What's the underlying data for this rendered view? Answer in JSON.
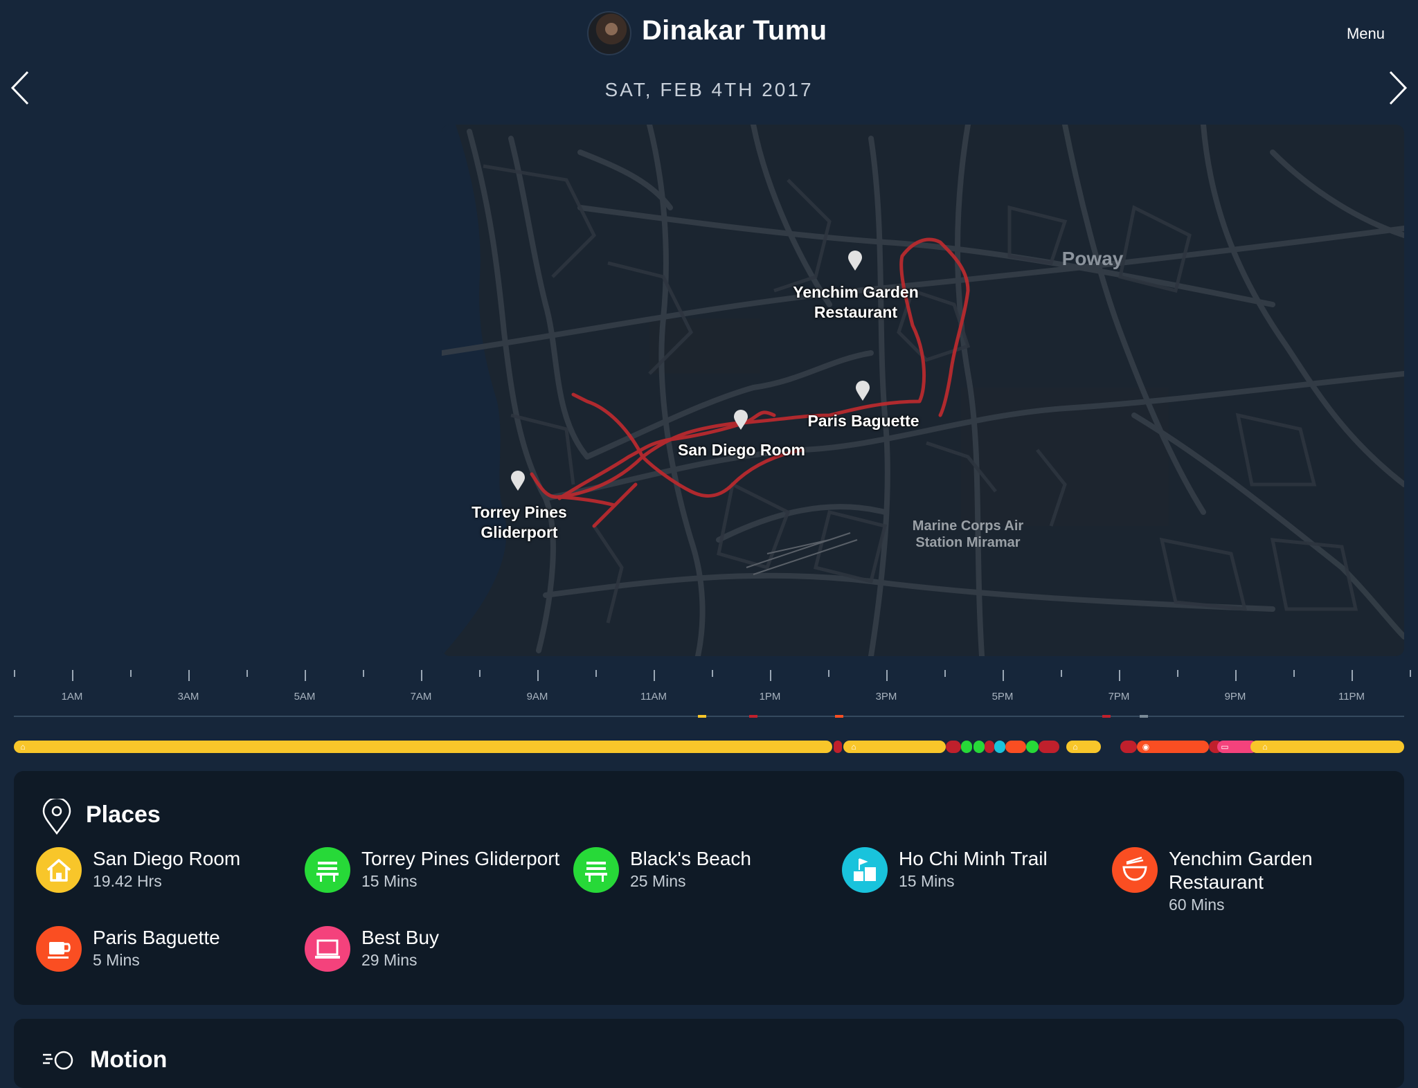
{
  "header": {
    "user_name": "Dinakar Tumu",
    "menu_label": "Menu",
    "date": "SAT, FEB 4TH 2017"
  },
  "map": {
    "places": [
      {
        "name": "Yenchim Garden\nRestaurant"
      },
      {
        "name": "Paris Baguette"
      },
      {
        "name": "San Diego Room"
      },
      {
        "name": "Torrey Pines\nGliderport"
      }
    ],
    "area_labels": [
      "Poway"
    ],
    "landmark_labels": [
      "Marine Corps Air\nStation Miramar"
    ],
    "route_color": "#b82a2e"
  },
  "timeline": {
    "hour_labels": [
      "1AM",
      "3AM",
      "5AM",
      "7AM",
      "9AM",
      "11AM",
      "1PM",
      "3PM",
      "5PM",
      "7PM",
      "9PM",
      "11PM"
    ],
    "colors": {
      "home": "#f8c62a",
      "transit": "#c0202c",
      "park": "#27d938",
      "trail": "#19c3dc",
      "restaurant": "#fa4e22",
      "cafe": "#fa4e22",
      "shop": "#f4427c"
    }
  },
  "places_card": {
    "title": "Places",
    "items": [
      {
        "name": "San Diego Room",
        "duration": "19.42 Hrs",
        "icon": "home-icon",
        "color": "#f8c62a"
      },
      {
        "name": "Torrey Pines Gliderport",
        "duration": "15 Mins",
        "icon": "park-icon",
        "color": "#27d938"
      },
      {
        "name": "Black's Beach",
        "duration": "25 Mins",
        "icon": "park-icon",
        "color": "#27d938"
      },
      {
        "name": "Ho Chi Minh Trail",
        "duration": "15 Mins",
        "icon": "trail-icon",
        "color": "#19c3dc"
      },
      {
        "name": "Yenchim Garden Restaurant",
        "duration": "60 Mins",
        "icon": "restaurant-icon",
        "color": "#fa4e22"
      },
      {
        "name": "Paris Baguette",
        "duration": "5 Mins",
        "icon": "cafe-icon",
        "color": "#fa4e22"
      },
      {
        "name": "Best Buy",
        "duration": "29 Mins",
        "icon": "computer-icon",
        "color": "#f4427c"
      }
    ]
  },
  "motion_card": {
    "title": "Motion"
  }
}
